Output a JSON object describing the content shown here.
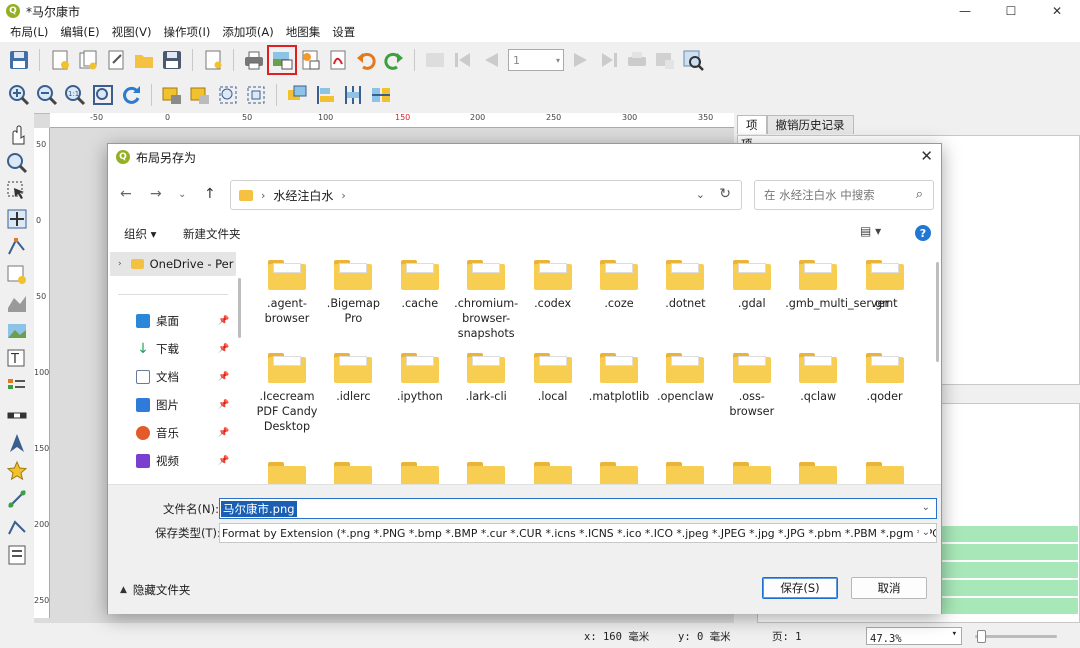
{
  "app": {
    "title": "*马尔康市",
    "window_controls": {
      "minimize": "—",
      "maximize": "☐",
      "close": "✕"
    }
  },
  "menu": [
    "布局(L)",
    "编辑(E)",
    "视图(V)",
    "操作项(I)",
    "添加项(A)",
    "地图集",
    "设置"
  ],
  "toolbar": {
    "page_value": "1",
    "highlighted_button": "export-image",
    "accent_color": "#e02020"
  },
  "rulers": {
    "h_ticks": [
      "-50",
      "0",
      "50",
      "100",
      "150",
      "200",
      "250",
      "300",
      "350"
    ],
    "v_ticks": [
      "50",
      "0",
      "50",
      "100",
      "150",
      "200",
      "250"
    ]
  },
  "right_panel": {
    "tabs": [
      "项",
      "撤销历史记录"
    ],
    "section_label": "项"
  },
  "status": {
    "x": "x: 160 毫米",
    "y": "y: 0 毫米",
    "page": "页: 1",
    "zoom": "47.3%"
  },
  "dialog": {
    "title": "布局另存为",
    "close": "✕",
    "path": "水经注白水",
    "search_placeholder": "在 水经注白水 中搜索",
    "organize": "组织 ▾",
    "new_folder": "新建文件夹",
    "nav": {
      "onedrive": "OneDrive - Per",
      "items": [
        {
          "label": "桌面",
          "icon": "desktop-icon",
          "color": "#2b88d8"
        },
        {
          "label": "下载",
          "icon": "download-icon",
          "color": "#1aa260"
        },
        {
          "label": "文档",
          "icon": "documents-icon",
          "color": "#6b7a99"
        },
        {
          "label": "图片",
          "icon": "pictures-icon",
          "color": "#2f7bd9"
        },
        {
          "label": "音乐",
          "icon": "music-icon",
          "color": "#e35b2a"
        },
        {
          "label": "视频",
          "icon": "videos-icon",
          "color": "#7b3fd0"
        }
      ]
    },
    "folders_row1": [
      ".agent-browser",
      ".Bigemap Pro",
      ".cache",
      ".chromium-browser-snapshots",
      ".codex",
      ".coze",
      ".dotnet",
      ".gdal",
      ".gmb_multi_server",
      ".gmt"
    ],
    "folders_row2": [
      ".Icecream PDF Candy Desktop",
      ".idlerc",
      ".ipython",
      ".lark-cli",
      ".local",
      ".matplotlib",
      ".openclaw",
      ".oss-browser",
      ".qclaw",
      ".qoder"
    ],
    "filename_label": "文件名(N):",
    "filename_value": "马尔康市.png",
    "filetype_label": "保存类型(T):",
    "filetype_value": "Format by Extension (*.png *.PNG *.bmp *.BMP *.cur *.CUR *.icns *.ICNS *.ico *.ICO *.jpeg *.JPEG *.jpg *.JPG *.pbm *.PBM *.pgm *.PGM *.",
    "hide_folders": "隐藏文件夹",
    "save": "保存(S)",
    "cancel": "取消"
  }
}
